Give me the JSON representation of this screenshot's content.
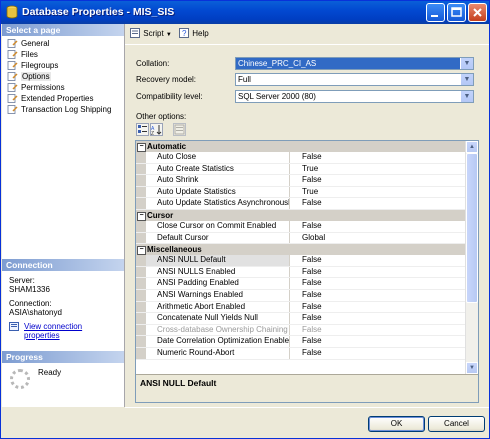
{
  "window": {
    "title": "Database Properties - MIS_SIS"
  },
  "left": {
    "select_page_header": "Select a page",
    "pages": [
      {
        "label": "General"
      },
      {
        "label": "Files"
      },
      {
        "label": "Filegroups"
      },
      {
        "label": "Options"
      },
      {
        "label": "Permissions"
      },
      {
        "label": "Extended Properties"
      },
      {
        "label": "Transaction Log Shipping"
      }
    ],
    "connection_header": "Connection",
    "server_label": "Server:",
    "server_value": "SHAM1336",
    "connection_label": "Connection:",
    "connection_value": "ASIA\\shatonyd",
    "view_link": "View connection properties",
    "progress_header": "Progress",
    "progress_status": "Ready"
  },
  "toolbar": {
    "script_label": "Script",
    "help_label": "Help"
  },
  "fields": {
    "collation_label": "Collation:",
    "collation_value": "Chinese_PRC_CI_AS",
    "recovery_label": "Recovery model:",
    "recovery_value": "Full",
    "compat_label": "Compatibility level:",
    "compat_value": "SQL Server 2000 (80)",
    "other_options_label": "Other options:"
  },
  "grid": {
    "automatic_cat": "Automatic",
    "automatic": [
      {
        "name": "Auto Close",
        "value": "False"
      },
      {
        "name": "Auto Create Statistics",
        "value": "True"
      },
      {
        "name": "Auto Shrink",
        "value": "False"
      },
      {
        "name": "Auto Update Statistics",
        "value": "True"
      },
      {
        "name": "Auto Update Statistics Asynchronously",
        "value": "False"
      }
    ],
    "cursor_cat": "Cursor",
    "cursor": [
      {
        "name": "Close Cursor on Commit Enabled",
        "value": "False"
      },
      {
        "name": "Default Cursor",
        "value": "Global"
      }
    ],
    "misc_cat": "Miscellaneous",
    "misc": [
      {
        "name": "ANSI NULL Default",
        "value": "False"
      },
      {
        "name": "ANSI NULLS Enabled",
        "value": "False"
      },
      {
        "name": "ANSI Padding Enabled",
        "value": "False"
      },
      {
        "name": "ANSI Warnings Enabled",
        "value": "False"
      },
      {
        "name": "Arithmetic Abort Enabled",
        "value": "False"
      },
      {
        "name": "Concatenate Null Yields Null",
        "value": "False"
      },
      {
        "name": "Cross-database Ownership Chaining Enabled",
        "value": "False"
      },
      {
        "name": "Date Correlation Optimization Enabled",
        "value": "False"
      },
      {
        "name": "Numeric Round-Abort",
        "value": "False"
      }
    ],
    "description_title": "ANSI NULL Default"
  },
  "buttons": {
    "ok": "OK",
    "cancel": "Cancel"
  },
  "colors": {
    "titlebar": "#0249d1",
    "selected_combo": "#316ac5",
    "link": "#0000cc"
  }
}
